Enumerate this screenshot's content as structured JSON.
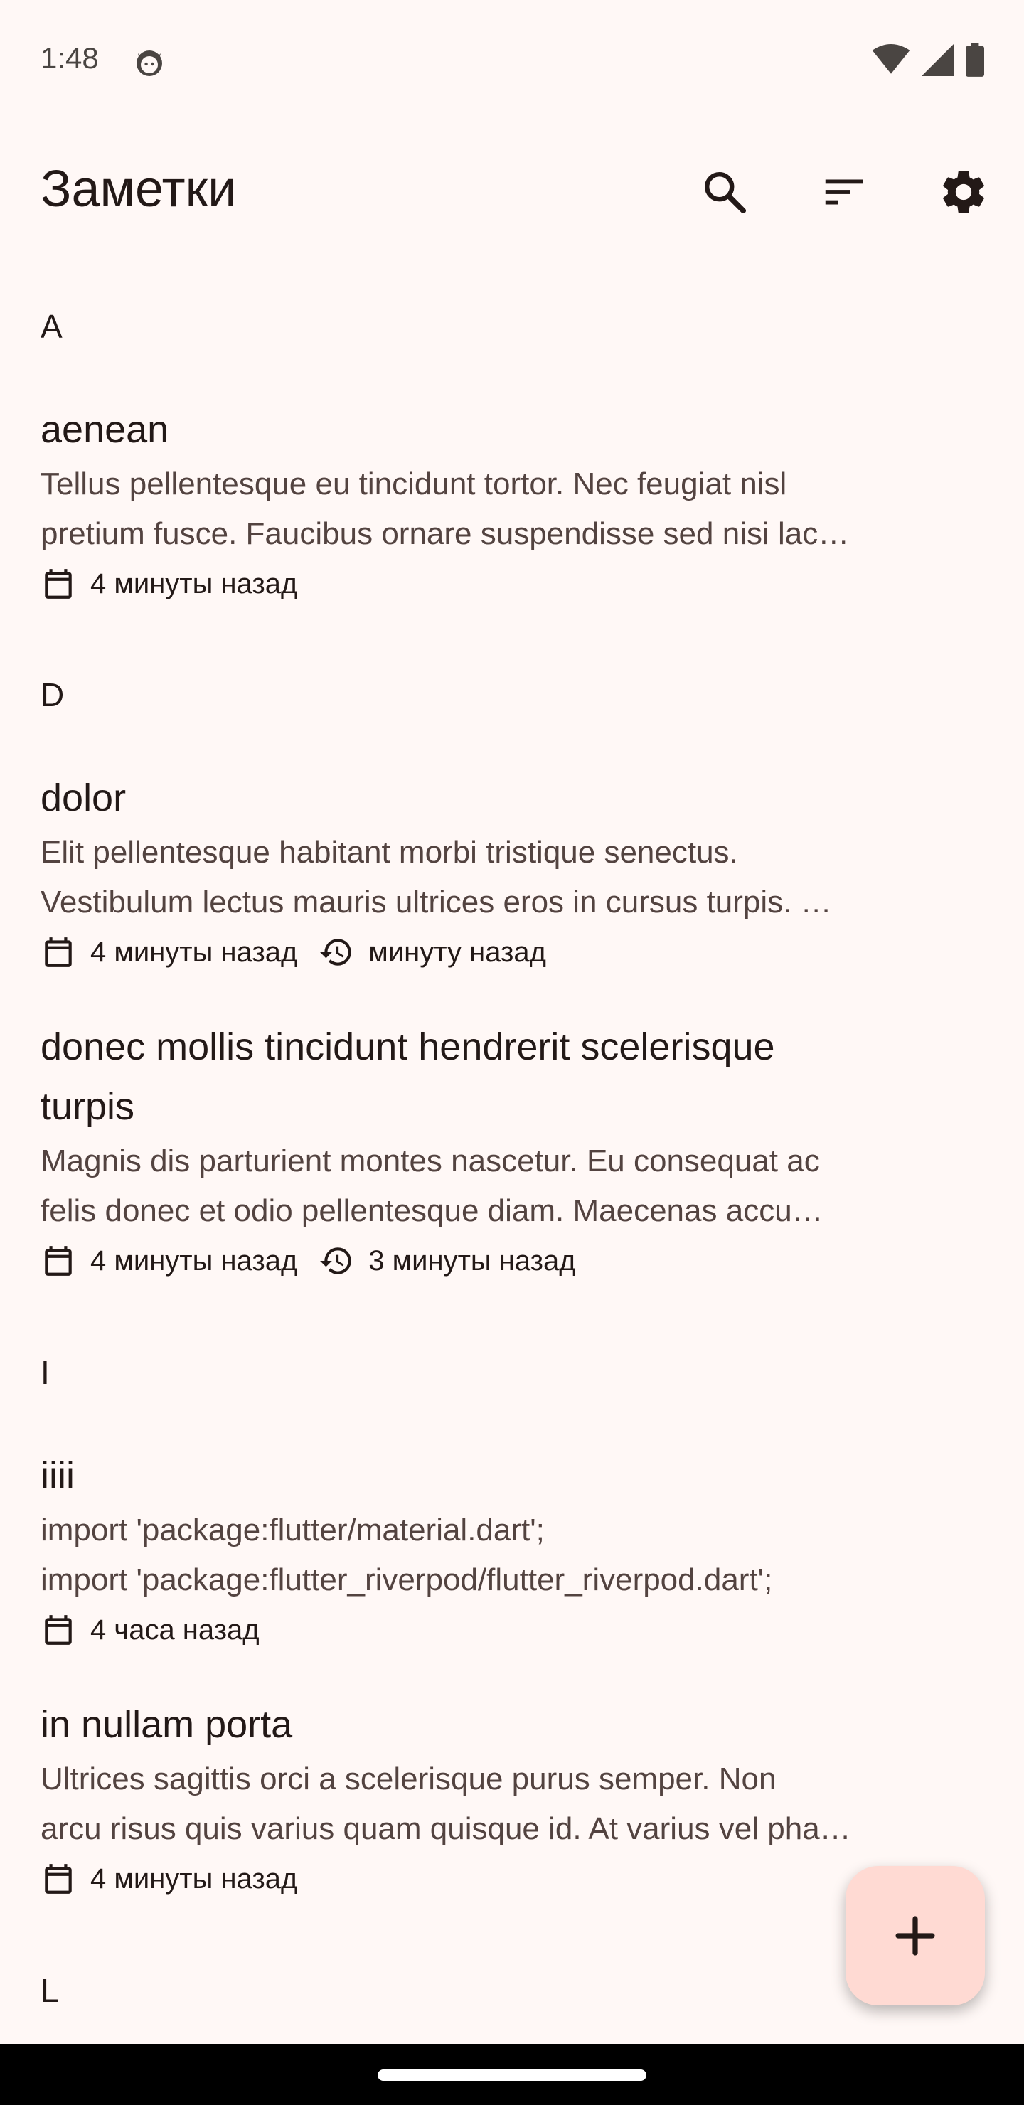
{
  "status_bar": {
    "time": "1:48",
    "icons": [
      "cat-icon",
      "wifi-icon",
      "signal-icon",
      "battery-icon"
    ]
  },
  "app_bar": {
    "title": "Заметки",
    "actions": [
      "search-icon",
      "sort-icon",
      "gear-icon"
    ]
  },
  "sections": [
    {
      "letter": "A",
      "notes": [
        {
          "title": "aenean",
          "body_line1": "Tellus pellentesque eu tincidunt tortor. Nec feugiat nisl",
          "body_line2": "pretium fusce. Faucibus ornare suspendisse sed nisi lac…",
          "created": "4 минуты назад"
        }
      ]
    },
    {
      "letter": "D",
      "notes": [
        {
          "title": "dolor",
          "body_line1": "Elit pellentesque habitant morbi tristique senectus.",
          "body_line2": "Vestibulum lectus mauris ultrices eros in cursus turpis. …",
          "created": "4 минуты назад",
          "modified": "минуту назад"
        },
        {
          "title_line1": "donec mollis tincidunt hendrerit scelerisque",
          "title_line2": "turpis",
          "body_line1": "Magnis dis parturient montes nascetur. Eu consequat ac",
          "body_line2": "felis donec et odio pellentesque diam. Maecenas accu…",
          "created": "4 минуты назад",
          "modified": "3 минуты назад"
        }
      ]
    },
    {
      "letter": "I",
      "notes": [
        {
          "title": "iiii",
          "body_line1": "import 'package:flutter/material.dart';",
          "body_line2": "import 'package:flutter_riverpod/flutter_riverpod.dart';",
          "created": "4 часа назад"
        },
        {
          "title": "in nullam porta",
          "body_line1": "Ultrices sagittis orci a scelerisque purus semper. Non",
          "body_line2": "arcu risus quis varius quam quisque id. At varius vel pha…",
          "created": "4 минуты назад"
        }
      ]
    },
    {
      "letter": "L",
      "notes": []
    }
  ],
  "fab": {
    "icon": "plus-icon"
  },
  "colors": {
    "background": "#fff8f6",
    "fab": "#ffdad3",
    "text": "#231917",
    "secondary_text": "#534340"
  }
}
